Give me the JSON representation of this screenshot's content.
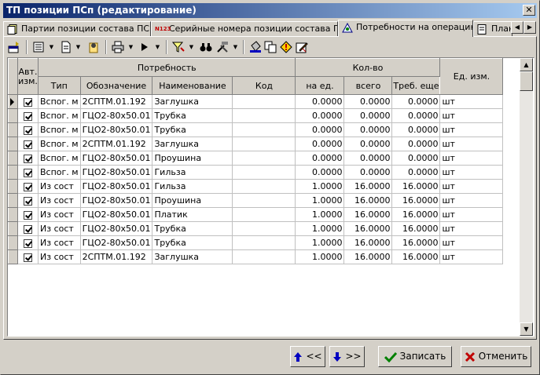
{
  "window": {
    "title": "ТП позиции ПСп (редактирование)"
  },
  "tabs": [
    {
      "label": "Партии позиции состава ПСп"
    },
    {
      "label": "Серийные номера позиции состава ПСп",
      "badge": "N123"
    },
    {
      "label": "Потребности на операцию"
    },
    {
      "label": "План"
    }
  ],
  "grid": {
    "group_headers": {
      "auto": "Авт. изм.",
      "need": "Потребность",
      "qty": "Кол-во",
      "unit": "Ед. изм."
    },
    "columns": {
      "type": "Тип",
      "designation": "Обозначение",
      "name": "Наименование",
      "code": "Код",
      "per_unit": "на ед.",
      "total": "всего",
      "required": "Треб. еще"
    },
    "rows": [
      [
        "Вспог. м",
        "2СПТМ.01.192",
        "Заглушка",
        "",
        "0.0000",
        "0.0000",
        "0.0000",
        "шт"
      ],
      [
        "Вспог. м",
        "ГЦО2-80x50.01",
        "Трубка",
        "",
        "0.0000",
        "0.0000",
        "0.0000",
        "шт"
      ],
      [
        "Вспог. м",
        "ГЦО2-80x50.01",
        "Трубка",
        "",
        "0.0000",
        "0.0000",
        "0.0000",
        "шт"
      ],
      [
        "Вспог. м",
        "2СПТМ.01.192",
        "Заглушка",
        "",
        "0.0000",
        "0.0000",
        "0.0000",
        "шт"
      ],
      [
        "Вспог. м",
        "ГЦО2-80x50.01",
        "Проушина",
        "",
        "0.0000",
        "0.0000",
        "0.0000",
        "шт"
      ],
      [
        "Вспог. м",
        "ГЦО2-80x50.01",
        "Гильза",
        "",
        "0.0000",
        "0.0000",
        "0.0000",
        "шт"
      ],
      [
        "Из сост",
        "ГЦО2-80x50.01",
        "Гильза",
        "",
        "1.0000",
        "16.0000",
        "16.0000",
        "шт"
      ],
      [
        "Из сост",
        "ГЦО2-80x50.01",
        "Проушина",
        "",
        "1.0000",
        "16.0000",
        "16.0000",
        "шт"
      ],
      [
        "Из сост",
        "ГЦО2-80x50.01",
        "Платик",
        "",
        "1.0000",
        "16.0000",
        "16.0000",
        "шт"
      ],
      [
        "Из сост",
        "ГЦО2-80x50.01",
        "Трубка",
        "",
        "1.0000",
        "16.0000",
        "16.0000",
        "шт"
      ],
      [
        "Из сост",
        "ГЦО2-80x50.01",
        "Трубка",
        "",
        "1.0000",
        "16.0000",
        "16.0000",
        "шт"
      ],
      [
        "Из сост",
        "2СПТМ.01.192",
        "Заглушка",
        "",
        "1.0000",
        "16.0000",
        "16.0000",
        "шт"
      ]
    ]
  },
  "buttons": {
    "prev": "<<",
    "next": ">>",
    "save": "Записать",
    "cancel": "Отменить"
  },
  "colors": {
    "titlebar": "#0a246a",
    "face": "#d4d0c8",
    "save_icon": "#008000",
    "cancel_icon": "#c00000",
    "arrow_icon": "#0000c0"
  }
}
